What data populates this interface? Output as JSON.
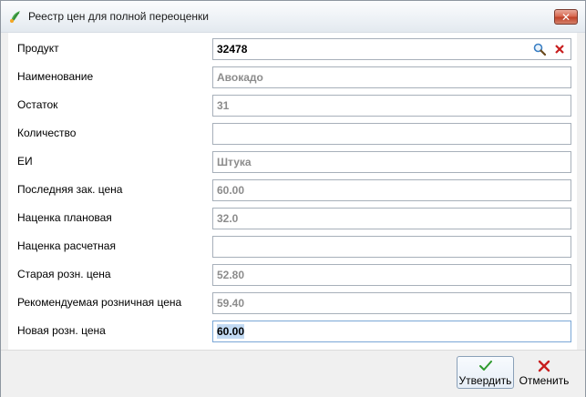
{
  "window": {
    "title": "Реестр цен для полной переоценки",
    "close_label": "✕"
  },
  "form": {
    "fields": [
      {
        "label": "Продукт",
        "value": "32478",
        "state": "active"
      },
      {
        "label": "Наименование",
        "value": "Авокадо",
        "state": "readonly"
      },
      {
        "label": "Остаток",
        "value": "31",
        "state": "readonly"
      },
      {
        "label": "Количество",
        "value": "",
        "state": "editable"
      },
      {
        "label": "ЕИ",
        "value": "Штука",
        "state": "readonly"
      },
      {
        "label": "Последняя зак. цена",
        "value": "60.00",
        "state": "readonly"
      },
      {
        "label": "Наценка плановая",
        "value": "32.0",
        "state": "readonly"
      },
      {
        "label": "Наценка расчетная",
        "value": "",
        "state": "editable"
      },
      {
        "label": "Старая розн. цена",
        "value": "52.80",
        "state": "readonly"
      },
      {
        "label": "Рекомендуемая розничная цена",
        "value": "59.40",
        "state": "readonly"
      },
      {
        "label": "Новая розн. цена",
        "value": "60.00",
        "state": "selected"
      }
    ],
    "product_icons": {
      "search": "search-icon",
      "clear": "clear-icon"
    }
  },
  "footer": {
    "confirm_label": "Утвердить",
    "cancel_label": "Отменить"
  },
  "colors": {
    "confirm_check": "#2e9a2e",
    "cancel_x": "#c81e1e",
    "clear_x": "#c81e1e",
    "search_lens": "#3a7fc4",
    "selection": "#c2daf3"
  }
}
